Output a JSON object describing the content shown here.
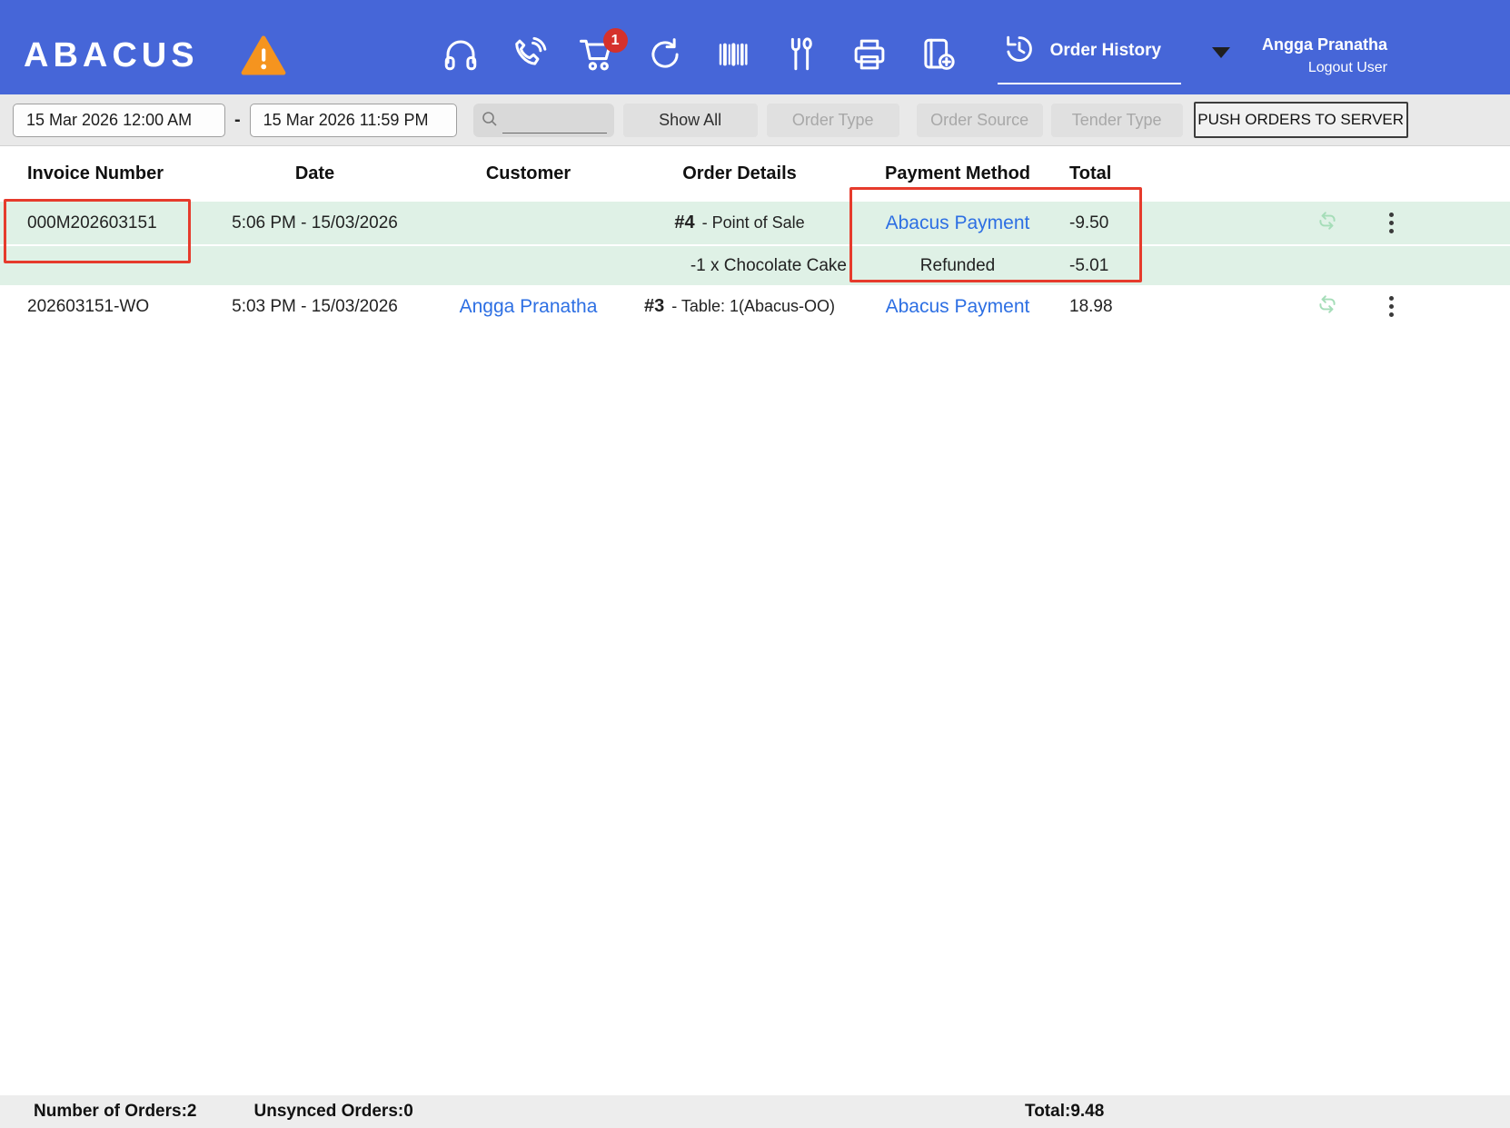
{
  "header": {
    "logo": "ABACUS",
    "cart_badge": "1",
    "dropdown_label": "Order History",
    "user_name": "Angga Pranatha",
    "logout_label": "Logout User"
  },
  "filters": {
    "date_from": "15 Mar 2026 12:00 AM",
    "range_separator": "-",
    "date_to": "15 Mar 2026 11:59 PM",
    "search_value": "",
    "buttons": {
      "show_all": "Show All",
      "order_type": "Order Type",
      "order_source": "Order Source",
      "tender_type": "Tender Type",
      "push_orders": "PUSH ORDERS TO SERVER"
    }
  },
  "table": {
    "headers": {
      "invoice": "Invoice Number",
      "date": "Date",
      "customer": "Customer",
      "order_details": "Order Details",
      "payment_method": "Payment Method",
      "total": "Total"
    },
    "rows": [
      {
        "invoice": "000M202603151",
        "date": "5:06 PM - 15/03/2026",
        "customer": "",
        "order_no": "#4",
        "order_desc": "- Point of Sale",
        "payment": "Abacus Payment",
        "total": "-9.50",
        "line_item": "-1 x Chocolate Cake",
        "line_status": "Refunded",
        "line_amount": "-5.01"
      },
      {
        "invoice": "202603151-WO",
        "date": "5:03 PM - 15/03/2026",
        "customer": "Angga Pranatha",
        "order_no": "#3",
        "order_desc": "- Table: 1(Abacus-OO)",
        "payment": "Abacus Payment",
        "total": "18.98"
      }
    ]
  },
  "footer": {
    "orders_label": "Number of Orders:",
    "orders_value": "2",
    "unsynced_label": "Unsynced Orders:",
    "unsynced_value": "0",
    "total_label": "Total:",
    "total_value": "9.48"
  },
  "colors": {
    "header_blue": "#4666d8",
    "link_blue": "#2d6fe3",
    "row_highlight_green": "#dff1e6",
    "annotation_red": "#e63b2c",
    "badge_red": "#d5312c",
    "warning_orange": "#f5941f",
    "sync_green": "#a5ddb8"
  }
}
